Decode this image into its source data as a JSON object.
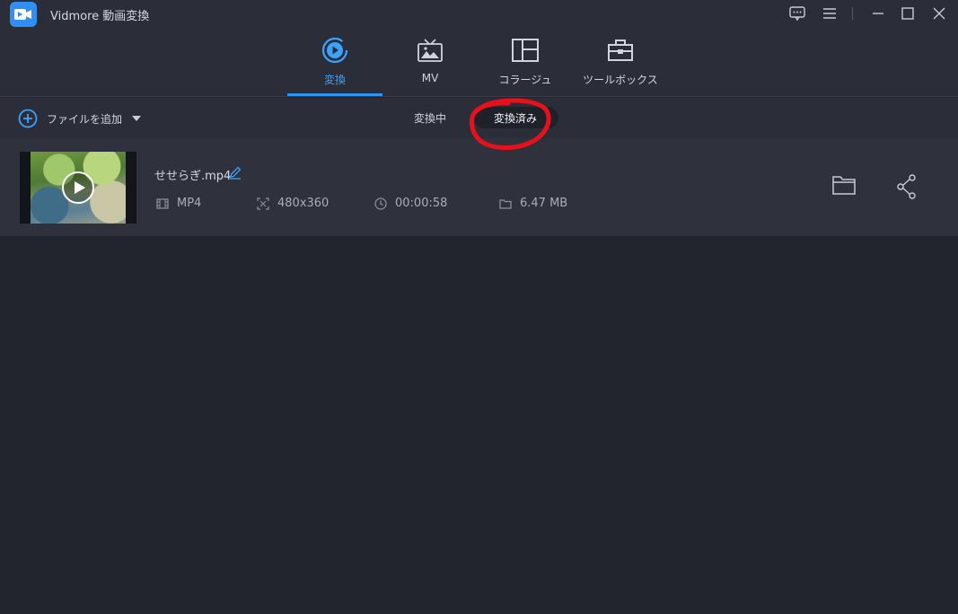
{
  "app": {
    "title": "Vidmore 動画変換",
    "logo_icon": "video-camera-logo-icon"
  },
  "window_controls": [
    "feedback-icon",
    "menu-icon",
    "minimize-icon",
    "maximize-icon",
    "close-icon"
  ],
  "nav": {
    "tabs": [
      {
        "label": "変換",
        "icon": "convert-icon",
        "active": true
      },
      {
        "label": "MV",
        "icon": "mv-tv-icon",
        "active": false
      },
      {
        "label": "コラージュ",
        "icon": "collage-icon",
        "active": false
      },
      {
        "label": "ツールボックス",
        "icon": "toolbox-icon",
        "active": false
      }
    ]
  },
  "toolbar": {
    "add_file_label": "ファイルを追加",
    "subtabs": [
      {
        "label": "変換中",
        "active": false
      },
      {
        "label": "変換済み",
        "active": true
      }
    ]
  },
  "files": [
    {
      "name": "せせらぎ.mp4",
      "format": "MP4",
      "resolution": "480x360",
      "duration": "00:00:58",
      "size": "6.47 MB"
    }
  ],
  "colors": {
    "accent": "#2e95f2",
    "background": "#22242e",
    "panel": "#2b2d38",
    "row": "#2f313d",
    "annotation": "#e8101a"
  }
}
